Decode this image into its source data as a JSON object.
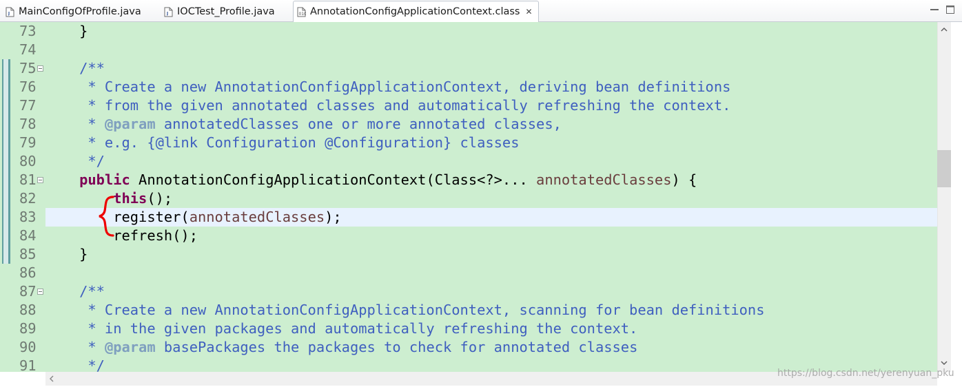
{
  "tabs": [
    {
      "label": "MainConfigOfProfile.java",
      "icon": "java-file-icon"
    },
    {
      "label": "IOCTest_Profile.java",
      "icon": "java-file-icon"
    },
    {
      "label": "AnnotationConfigApplicationContext.class",
      "icon": "class-file-icon",
      "active": true,
      "close": "✕"
    }
  ],
  "window_controls": {
    "minimize": "minimize-icon",
    "maximize": "maximize-icon"
  },
  "editor": {
    "background": "#cdeed0",
    "current_line": 83,
    "lines": [
      {
        "n": "73",
        "segs": [
          {
            "t": "    }",
            "c": "plain"
          }
        ]
      },
      {
        "n": "74",
        "segs": []
      },
      {
        "n": "75",
        "fold": true,
        "segs": [
          {
            "t": "    /**",
            "c": "jdoc"
          }
        ]
      },
      {
        "n": "76",
        "segs": [
          {
            "t": "     * Create a new AnnotationConfigApplicationContext, deriving bean definitions",
            "c": "jdoc"
          }
        ]
      },
      {
        "n": "77",
        "segs": [
          {
            "t": "     * from the given annotated classes and automatically refreshing the context.",
            "c": "jdoc"
          }
        ]
      },
      {
        "n": "78",
        "segs": [
          {
            "t": "     * ",
            "c": "jdoc"
          },
          {
            "t": "@param",
            "c": "jtag"
          },
          {
            "t": " annotatedClasses one or more annotated classes,",
            "c": "jdoc"
          }
        ]
      },
      {
        "n": "79",
        "segs": [
          {
            "t": "     * e.g. {@link Configuration @Configuration} classes",
            "c": "jdoc"
          }
        ]
      },
      {
        "n": "80",
        "segs": [
          {
            "t": "     */",
            "c": "jdoc"
          }
        ]
      },
      {
        "n": "81",
        "fold": true,
        "segs": [
          {
            "t": "    ",
            "c": "plain"
          },
          {
            "t": "public",
            "c": "kw"
          },
          {
            "t": " AnnotationConfigApplicationContext(Class<?>... ",
            "c": "plain"
          },
          {
            "t": "annotatedClasses",
            "c": "param"
          },
          {
            "t": ") {",
            "c": "plain"
          }
        ]
      },
      {
        "n": "82",
        "segs": [
          {
            "t": "        ",
            "c": "plain"
          },
          {
            "t": "this",
            "c": "kw"
          },
          {
            "t": "();",
            "c": "plain"
          }
        ]
      },
      {
        "n": "83",
        "segs": [
          {
            "t": "        register(",
            "c": "plain"
          },
          {
            "t": "annotatedClasses",
            "c": "param"
          },
          {
            "t": ");",
            "c": "plain"
          }
        ]
      },
      {
        "n": "84",
        "segs": [
          {
            "t": "        refresh();",
            "c": "plain"
          }
        ]
      },
      {
        "n": "85",
        "segs": [
          {
            "t": "    }",
            "c": "plain"
          }
        ]
      },
      {
        "n": "86",
        "segs": []
      },
      {
        "n": "87",
        "fold": true,
        "segs": [
          {
            "t": "    /**",
            "c": "jdoc"
          }
        ]
      },
      {
        "n": "88",
        "segs": [
          {
            "t": "     * Create a new AnnotationConfigApplicationContext, scanning for bean definitions",
            "c": "jdoc"
          }
        ]
      },
      {
        "n": "89",
        "segs": [
          {
            "t": "     * in the given packages and automatically refreshing the context.",
            "c": "jdoc"
          }
        ]
      },
      {
        "n": "90",
        "segs": [
          {
            "t": "     * ",
            "c": "jdoc"
          },
          {
            "t": "@param",
            "c": "jtag"
          },
          {
            "t": " basePackages the packages to check for annotated classes",
            "c": "jdoc"
          }
        ]
      },
      {
        "n": "91",
        "segs": [
          {
            "t": "     */",
            "c": "jdoc"
          }
        ]
      }
    ]
  },
  "annotation": {
    "shape": "curly-brace",
    "color": "#ee0000"
  },
  "watermark": "https://blog.csdn.net/yerenyuan_pku"
}
